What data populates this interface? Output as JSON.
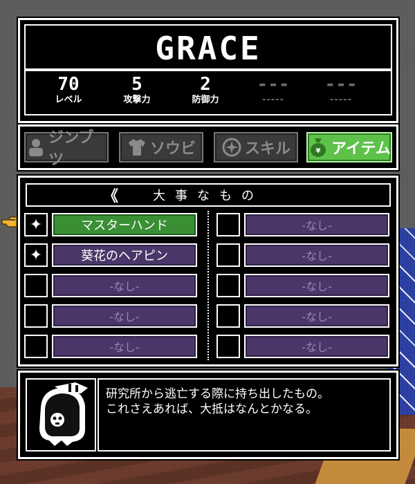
{
  "character": {
    "name": "GRACE"
  },
  "stats": [
    {
      "value": "70",
      "label": "レベル",
      "dim": false
    },
    {
      "value": "5",
      "label": "攻撃力",
      "dim": false
    },
    {
      "value": "2",
      "label": "防御力",
      "dim": false
    },
    {
      "value": "---",
      "label": "-----",
      "dim": true
    },
    {
      "value": "---",
      "label": "-----",
      "dim": true
    }
  ],
  "tabs": [
    {
      "label": "ジンブツ",
      "icon": "person-icon",
      "active": false
    },
    {
      "label": "ソウビ",
      "icon": "shirt-icon",
      "active": false
    },
    {
      "label": "スキル",
      "icon": "compass-star-icon",
      "active": false
    },
    {
      "label": "アイテム",
      "icon": "bag-icon",
      "active": true
    }
  ],
  "section": {
    "back_arrow": "《",
    "title": "大事なもの"
  },
  "items_left": [
    {
      "name": "マスターハンド",
      "owned": true,
      "selected": true
    },
    {
      "name": "葵花のヘアピン",
      "owned": true,
      "selected": false
    },
    {
      "name": "-なし-",
      "owned": false,
      "selected": false
    },
    {
      "name": "-なし-",
      "owned": false,
      "selected": false
    },
    {
      "name": "-なし-",
      "owned": false,
      "selected": false
    }
  ],
  "items_right": [
    {
      "name": "-なし-",
      "owned": false,
      "selected": false
    },
    {
      "name": "-なし-",
      "owned": false,
      "selected": false
    },
    {
      "name": "-なし-",
      "owned": false,
      "selected": false
    },
    {
      "name": "-なし-",
      "owned": false,
      "selected": false
    },
    {
      "name": "-なし-",
      "owned": false,
      "selected": false
    }
  ],
  "owned_mark": "✦",
  "description": {
    "line1": "研究所から逃亡する際に持ち出したもの。",
    "line2": "これさえあれば、大抵はなんとかなる。"
  },
  "colors": {
    "active_tab": "#5ec24a",
    "selected_item": "#3a8f34",
    "empty_item": "#4a3668"
  }
}
